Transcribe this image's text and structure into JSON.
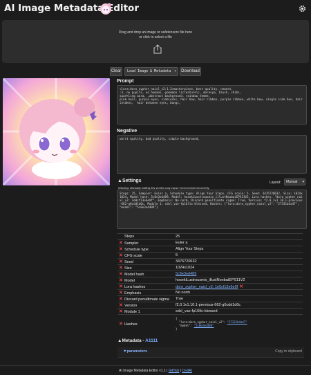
{
  "header": {
    "title": "AI Image Metadata Editor",
    "settings_icon": "gear-icon",
    "logo_icon": "chibi-logo-icon"
  },
  "dropzone": {
    "line1": "Drag and drop an image or safetensors file here",
    "line2": "or click to select a file",
    "icon": "share-upload-icon"
  },
  "toolbar": {
    "clear_label": "Clear",
    "load_select_value": "Load Image & Metadata",
    "download_label": "Download"
  },
  "prompt": {
    "label": "Prompt",
    "text": "<lora:doro_xypher_naixl_v2:1.2>masterpiece, best quality, newest,\n:3, no pupils, no humans, pokemon \\(creature\\), dorosya, blush, chibi,\nsparkling aura, ,abstract background, rainbow theme,\npink hair, purple eyes, sidelocks, hair bow, hair ribbon, purple ribbon, white bow, single side bun, hair intakes,  hair between eyes, bangs,"
  },
  "negative": {
    "label": "Negative",
    "text": "worst quality, bad quality, simple background,"
  },
  "settings": {
    "label": "Settings",
    "toggle": "▲",
    "layout_label": "Layout:",
    "layout_value": "Manual",
    "warning": "Warning: Manually editing this section may cause errors if done incorrectly.",
    "raw": "Steps: 25, Sampler: Euler a, Schedule type: Align Your Steps, CFG scale: 5, Seed: 3476720632, Size: 1024x1024, Model hash: 5c8e3ed489, Model: hosekiLustrousmix_illustNoobaiEPS11V2, Lora hashes: \"doro_xypher_naixl_v2: 1e0cf13e6e9f\", Emphasis: No norm, Discard penultimate sigma: True, Version: f2.0.1v1.10.1-previous-662-g0cdd1d0c, Module 1: sdxl_vae-fp16fix-blessed, Hashes: {\"lora:doro_xypher_naixl_v2\": \"27331b4a47\", \"model\": \"5c8e3ed489\"}"
  },
  "params": [
    {
      "key": "Steps",
      "value": "25",
      "removable": false
    },
    {
      "key": "Sampler",
      "value": "Euler a",
      "removable": true
    },
    {
      "key": "Schedule type",
      "value": "Align Your Steps",
      "removable": true
    },
    {
      "key": "CFG scale",
      "value": "5",
      "removable": true
    },
    {
      "key": "Seed",
      "value": "3476720632",
      "removable": true
    },
    {
      "key": "Size",
      "value": "1024x1024",
      "removable": true
    },
    {
      "key": "Model hash",
      "value": "5c8e3ed489",
      "removable": true,
      "link": true
    },
    {
      "key": "Model",
      "value": "hosekiLustrousmix_illustNoobaiEPS11V2",
      "removable": true
    },
    {
      "key": "Lora hashes",
      "value": "doro_xypher_naixl_v2: 1e0cf13e6e9f",
      "removable": true,
      "link": true,
      "extra_x": true
    },
    {
      "key": "Emphasis",
      "value": "No norm",
      "removable": true
    },
    {
      "key": "Discard penultimate sigma",
      "value": "True",
      "removable": true
    },
    {
      "key": "Version",
      "value": "f2.0.1v1.10.1-previous-662-g0cdd1d0c",
      "removable": true
    },
    {
      "key": "Module 1",
      "value": "sdxl_vae-fp16fix-blessed",
      "removable": true
    }
  ],
  "hashes_row": {
    "key": "Hashes",
    "open": "{",
    "lora_key": "\"lora:doro_xypher_naixl_v2\": ",
    "lora_val": "\"27331b4a47\"",
    "model_key": "\"model\": ",
    "model_val": "\"5c8e3ed489\"",
    "close": "}"
  },
  "metadata": {
    "toggle": "▲",
    "label": "Metadata - ",
    "source": "A1111",
    "params_label": "▼parameters",
    "copy_label": "Copy to clipboard"
  },
  "footer": {
    "text": "AI Image Metadata Editor v1.1 | ",
    "github": "GitHub",
    "sep": " | ",
    "civitai": "CivitAI"
  },
  "colors": {
    "background": "#1c1c1c",
    "panel": "#2c2c2c",
    "accent_link": "#7fb2ff",
    "remove_red": "#e24a4a"
  }
}
